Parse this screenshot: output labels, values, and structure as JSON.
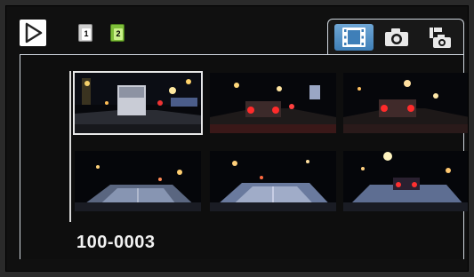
{
  "top_bar": {
    "play_icon": "play-icon",
    "storage": [
      {
        "label": "1",
        "icon": "sd-card-1-icon",
        "color": "#ffffff"
      },
      {
        "label": "2",
        "icon": "sd-card-2-icon",
        "color": "#7fbf3a"
      }
    ]
  },
  "tabs": [
    {
      "icon": "film-strip-icon",
      "selected": true
    },
    {
      "icon": "camera-icon",
      "selected": false
    },
    {
      "icon": "event-camera-icon",
      "selected": false
    }
  ],
  "thumbnails": [
    {
      "scene": "night-city-truck",
      "selected": true
    },
    {
      "scene": "night-street-taillights",
      "selected": false
    },
    {
      "scene": "night-street-taillights-2",
      "selected": false
    },
    {
      "scene": "night-highway",
      "selected": false
    },
    {
      "scene": "night-highway-2",
      "selected": false
    },
    {
      "scene": "night-intersection",
      "selected": false
    }
  ],
  "folder_label": "100-0003",
  "colors": {
    "accent": "#4f8fc6",
    "frame": "#cfd6de",
    "background": "#101010"
  }
}
